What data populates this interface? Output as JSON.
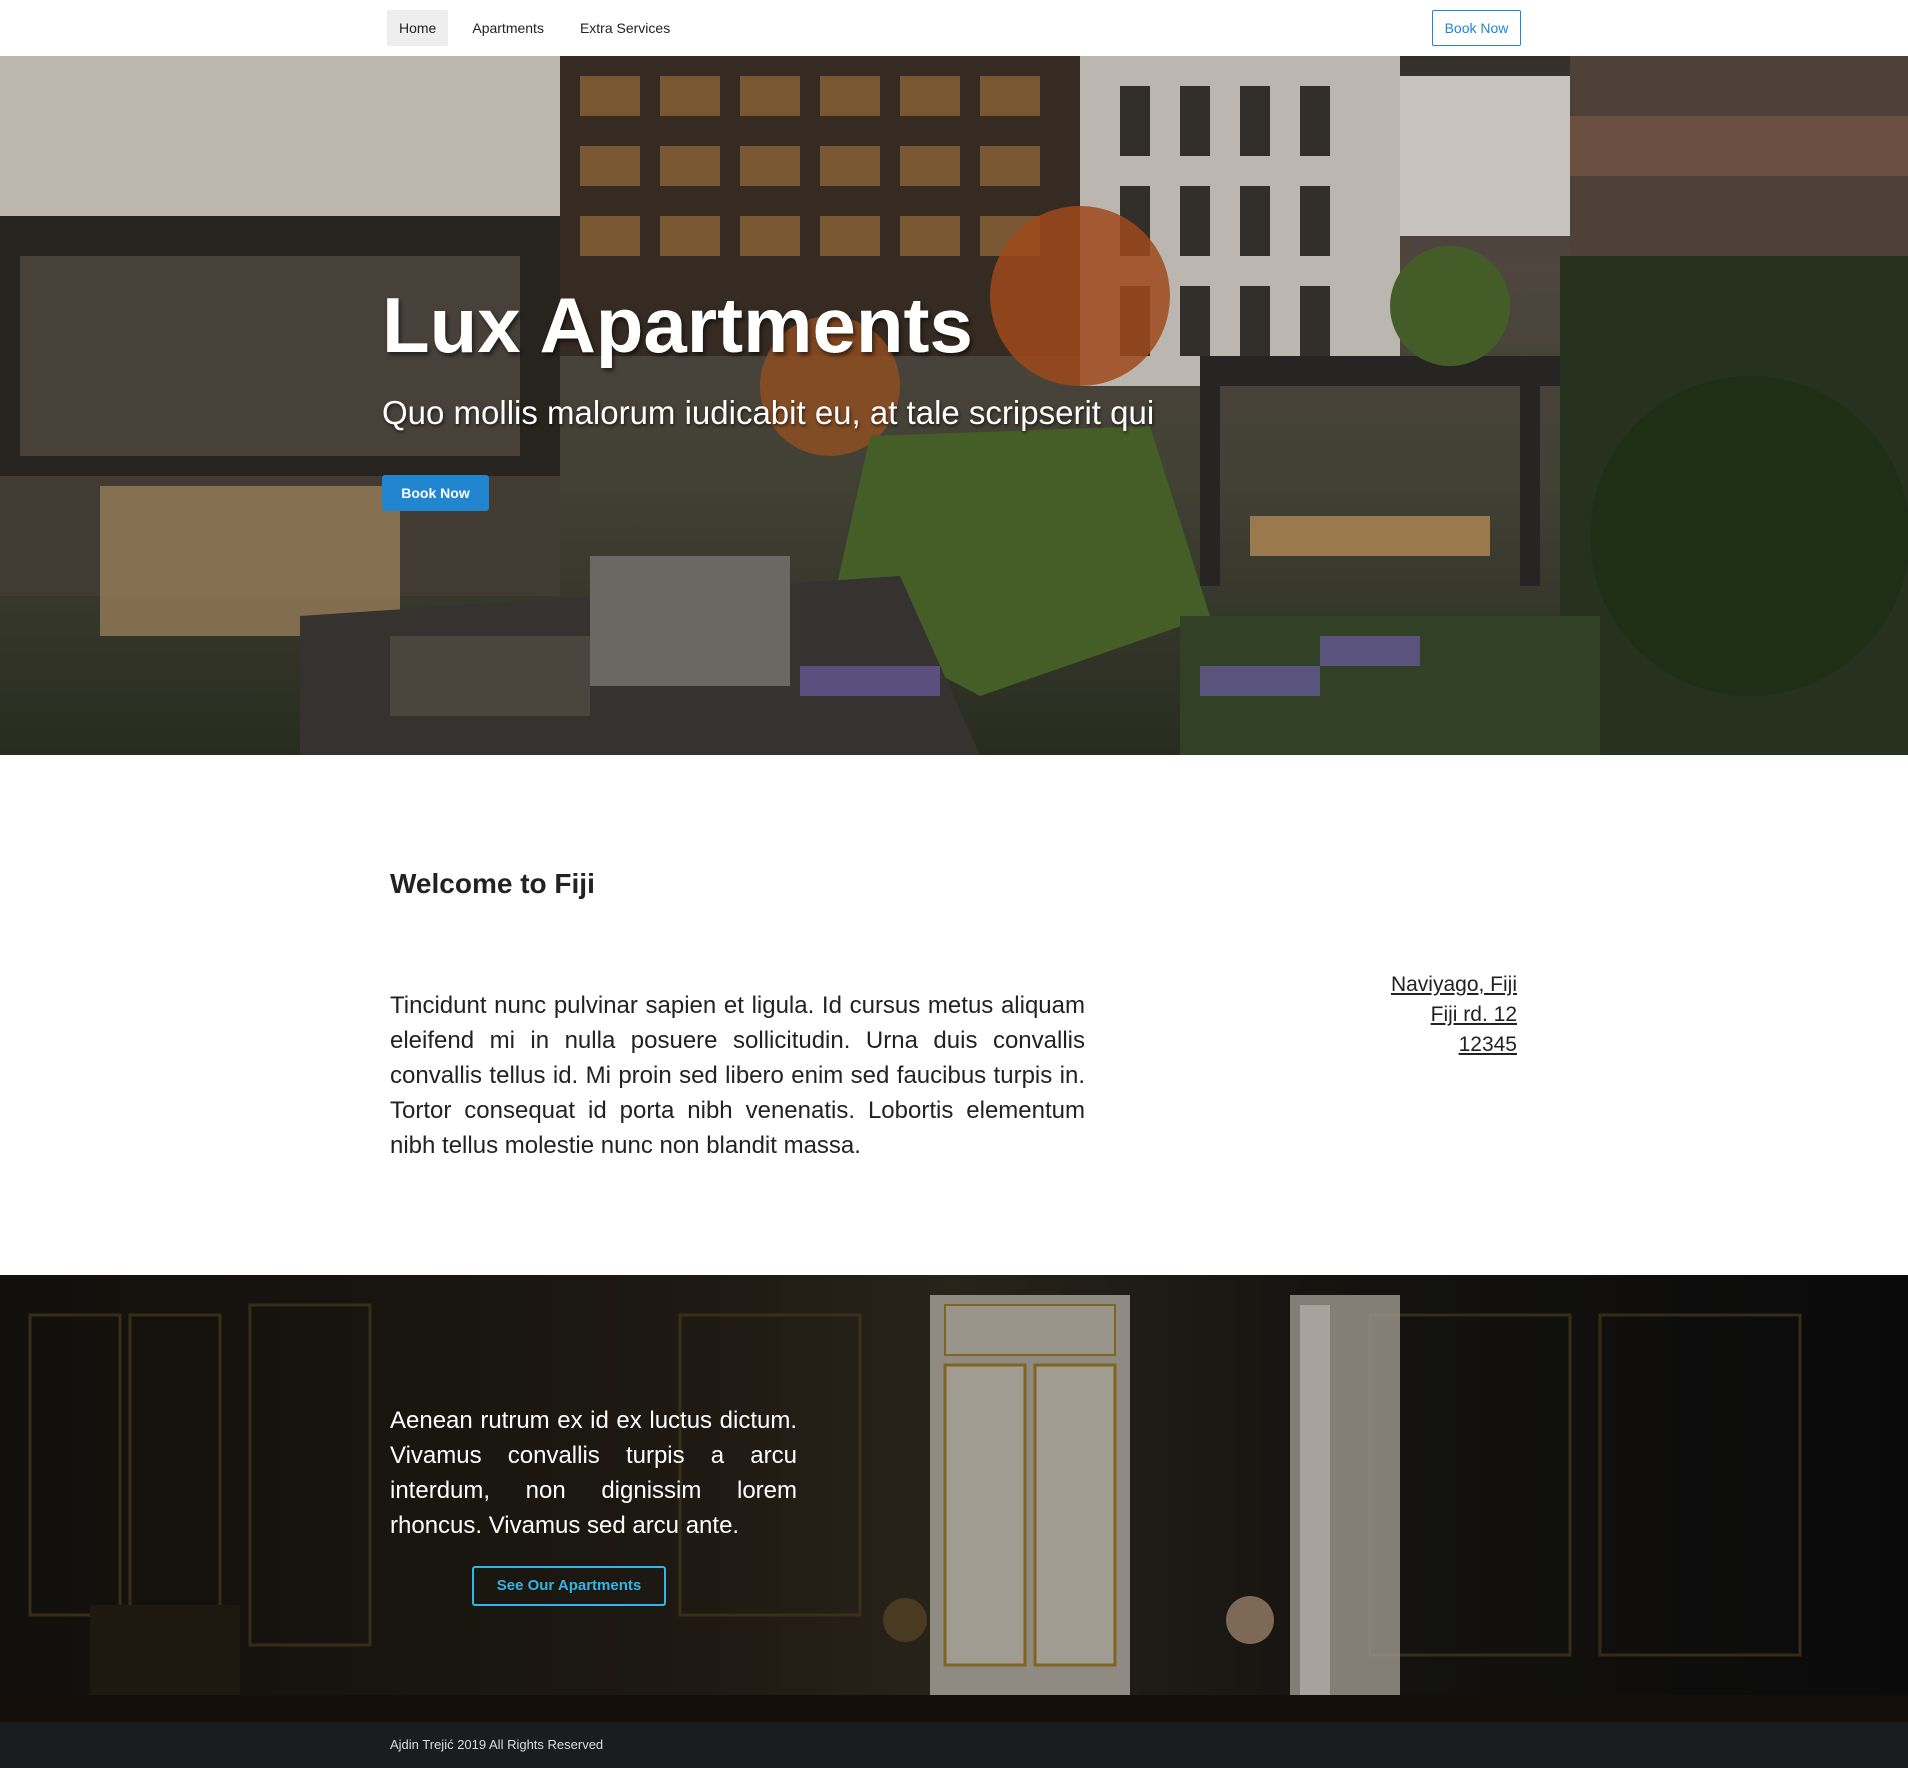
{
  "nav": {
    "links": [
      "Home",
      "Apartments",
      "Extra Services"
    ],
    "active": "Home",
    "book_label": "Book Now"
  },
  "hero": {
    "title": "Lux Apartments",
    "subtitle": "Quo mollis malorum iudicabit eu, at tale scripserit qui",
    "button_label": "Book Now"
  },
  "welcome": {
    "title": "Welcome to Fiji",
    "text": "Tincidunt nunc pulvinar sapien et ligula. Id cursus metus aliquam eleifend mi in nulla posuere sollicitudin. Urna duis convallis convallis tellus id. Mi proin sed libero enim sed faucibus turpis in. Tortor consequat id porta nibh venenatis. Lobortis elementum nibh tellus molestie nunc non blandit massa.",
    "address": [
      "Naviyago, Fiji",
      "Fiji rd. 12",
      "12345"
    ]
  },
  "promo": {
    "text": "Aenean rutrum ex id ex luctus dictum. Vivamus convallis turpis a arcu interdum, non dignissim lorem rhoncus. Vivamus sed arcu ante.",
    "button_label": "See Our Apartments"
  },
  "footer": {
    "text": "Ajdin Trejić 2019 All Rights Reserved"
  },
  "colors": {
    "accent": "#2185d0",
    "promo_button": "#33b5e5",
    "footer_bg": "#1b1c1d"
  }
}
